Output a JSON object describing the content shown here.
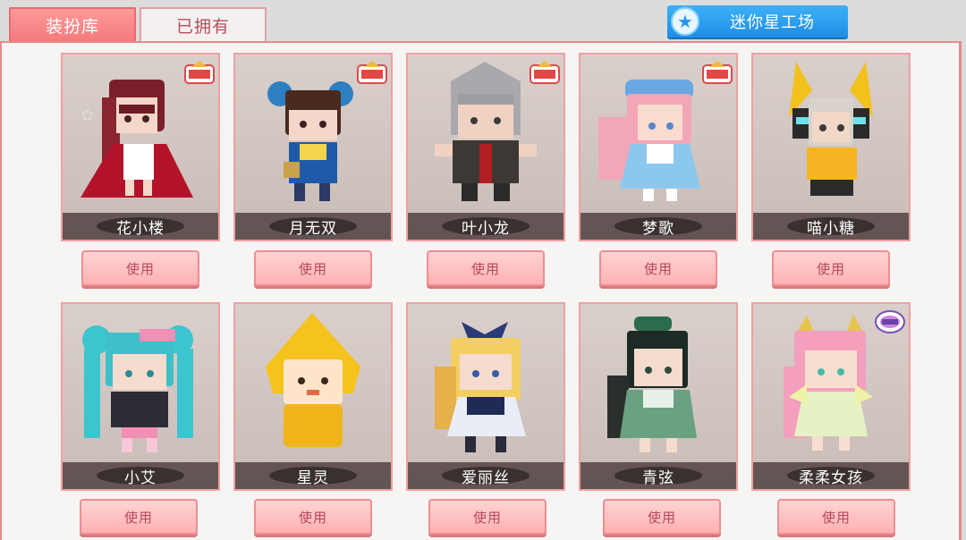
{
  "tabs": [
    {
      "label": "装扮库",
      "active": true
    },
    {
      "label": "已拥有",
      "active": false
    }
  ],
  "workshop": {
    "label": "迷你星工场",
    "icon": "star-icon"
  },
  "badges": {
    "exchange": "换装",
    "mlp": "MY LITTLE PONY"
  },
  "colors": {
    "accent": "#f47a7d",
    "workshop_blue": "#1f8de4",
    "button_text": "#b4485a"
  },
  "skins": [
    {
      "name": "花小楼",
      "button": "使用",
      "badge": "exchange-badge"
    },
    {
      "name": "月无双",
      "button": "使用",
      "badge": "exchange-badge"
    },
    {
      "name": "叶小龙",
      "button": "使用",
      "badge": "exchange-badge"
    },
    {
      "name": "梦歌",
      "button": "使用",
      "badge": "exchange-badge"
    },
    {
      "name": "喵小糖",
      "button": "使用",
      "badge": ""
    },
    {
      "name": "小艾",
      "button": "使用",
      "badge": ""
    },
    {
      "name": "星灵",
      "button": "使用",
      "badge": ""
    },
    {
      "name": "爱丽丝",
      "button": "使用",
      "badge": ""
    },
    {
      "name": "青弦",
      "button": "使用",
      "badge": ""
    },
    {
      "name": "柔柔女孩",
      "button": "使用",
      "badge": "mlp-badge"
    }
  ]
}
